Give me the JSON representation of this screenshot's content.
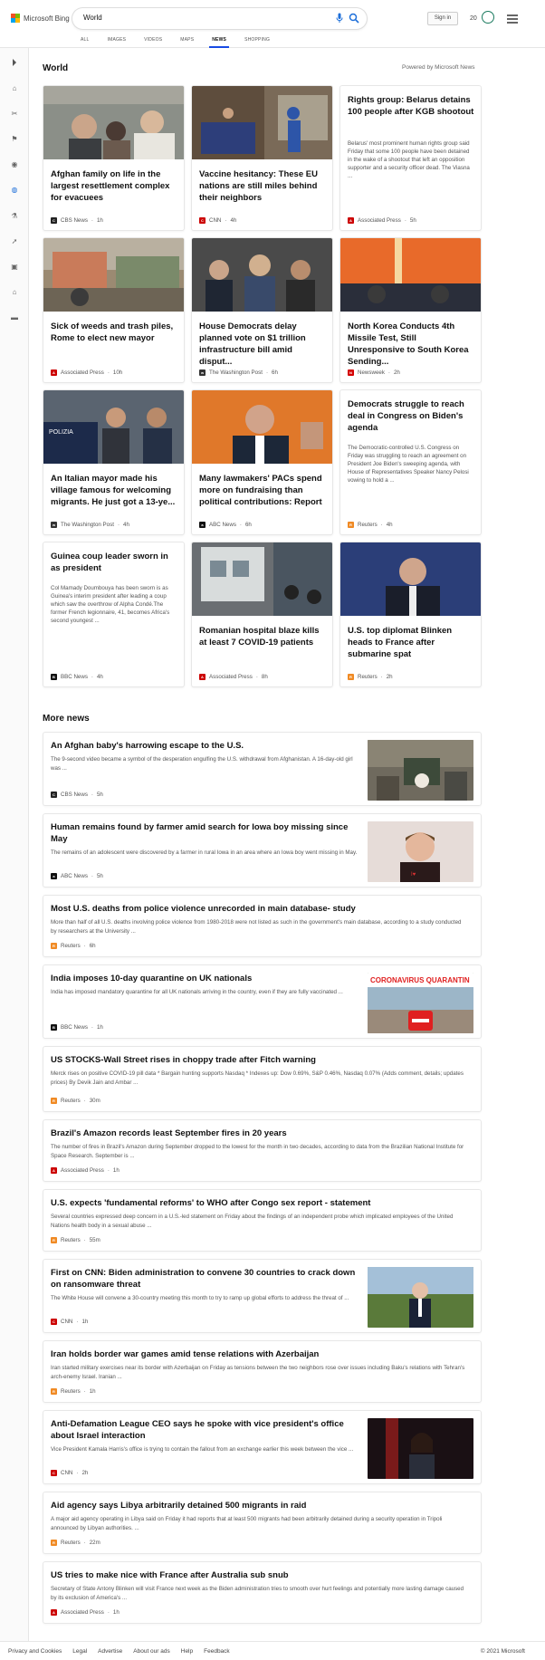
{
  "header": {
    "brand": "Microsoft Bing",
    "search_value": "World",
    "signin_label": "Sign in",
    "rewards_count": "20",
    "logo_colors": [
      "#f25022",
      "#7fba00",
      "#00a4ef",
      "#ffb900"
    ],
    "accent": "#174ae4"
  },
  "tabs": [
    {
      "label": "ALL",
      "active": false
    },
    {
      "label": "IMAGES",
      "active": false
    },
    {
      "label": "VIDEOS",
      "active": false
    },
    {
      "label": "MAPS",
      "active": false
    },
    {
      "label": "NEWS",
      "active": true
    },
    {
      "label": "SHOPPING",
      "active": false
    }
  ],
  "rail": {
    "icons": [
      "chevron-right-icon",
      "home-icon",
      "scissors-icon",
      "flag-icon",
      "location-pin-icon",
      "globe-icon",
      "microscope-icon",
      "rocket-icon",
      "film-icon",
      "bank-icon",
      "credit-card-icon"
    ]
  },
  "world": {
    "title": "World",
    "powered_by": "Powered by Microsoft News",
    "cards": [
      {
        "title": "Afghan family on life in the largest resettlement complex for evacuees",
        "source": "CBS News",
        "time": "1h",
        "src_color": "#222",
        "src_icon": "CBS",
        "has_image": true
      },
      {
        "title": "Vaccine hesitancy: These EU nations are still miles behind their neighbors",
        "source": "CNN",
        "time": "4h",
        "src_color": "#cc0000",
        "src_icon": "CNN",
        "has_image": true
      },
      {
        "title": "Rights group: Belarus detains 100 people after KGB shootout",
        "snippet": "Belarus' most prominent human rights group said Friday that some 100 people have been detained in the wake of a shootout that left an opposition supporter and a security officer dead. The Viasna ...",
        "source": "Associated Press",
        "time": "5h",
        "src_color": "#cc0000",
        "src_icon": "AP",
        "has_image": false
      },
      {
        "title": "Sick of weeds and trash piles, Rome to elect new mayor",
        "source": "Associated Press",
        "time": "10h",
        "src_color": "#cc0000",
        "src_icon": "AP",
        "has_image": true
      },
      {
        "title": "House Democrats delay planned vote on $1 trillion infrastructure bill amid disput...",
        "source": "The Washington Post",
        "time": "6h",
        "src_color": "#333",
        "src_icon": "wp",
        "has_image": true
      },
      {
        "title": "North Korea Conducts 4th Missile Test, Still Unresponsive to South Korea Sending...",
        "source": "Newsweek",
        "time": "2h",
        "src_color": "#d40000",
        "src_icon": "N",
        "has_image": true
      },
      {
        "title": "An Italian mayor made his village famous for welcoming migrants. He just got a 13-ye...",
        "source": "The Washington Post",
        "time": "4h",
        "src_color": "#333",
        "src_icon": "wp",
        "has_image": true
      },
      {
        "title": "Many lawmakers' PACs spend more on fundraising than political contributions: Report",
        "source": "ABC News",
        "time": "6h",
        "src_color": "#111",
        "src_icon": "abc",
        "has_image": true
      },
      {
        "title": "Democrats struggle to reach deal in Congress on Biden's agenda",
        "snippet": "The Democratic-controlled U.S. Congress on Friday was struggling to reach an agreement on President Joe Biden's sweeping agenda, with House of Representatives Speaker Nancy Pelosi vowing to hold a ...",
        "source": "Reuters",
        "time": "4h",
        "src_color": "#f08a24",
        "src_icon": "R",
        "has_image": false
      },
      {
        "title": "Guinea coup leader sworn in as president",
        "snippet": "Col Mamady Doumbouya has been sworn is as Guinea's interim president after leading a coup which saw the overthrow of Alpha Condé.The former French legionnaire, 41, becomes Africa's second youngest ...",
        "source": "BBC News",
        "time": "4h",
        "src_color": "#111",
        "src_icon": "BBC",
        "has_image": false
      },
      {
        "title": "Romanian hospital blaze kills at least 7 COVID-19 patients",
        "source": "Associated Press",
        "time": "8h",
        "src_color": "#cc0000",
        "src_icon": "AP",
        "has_image": true
      },
      {
        "title": "U.S. top diplomat Blinken heads to France after submarine spat",
        "source": "Reuters",
        "time": "2h",
        "src_color": "#f08a24",
        "src_icon": "R",
        "has_image": true
      }
    ]
  },
  "more_news": {
    "title": "More news",
    "items": [
      {
        "title": "An Afghan baby's harrowing escape to the U.S.",
        "snippet": "The 9-second video became a symbol of the desperation engulfing the U.S. withdrawal from Afghanistan. A 16-day-old girl was ...",
        "source": "CBS News",
        "time": "5h",
        "src_color": "#222",
        "src_icon": "CBS",
        "thumb": "baby"
      },
      {
        "title": "Human remains found by farmer amid search for Iowa boy missing since May",
        "snippet": "The remains of an adolescent were discovered by a farmer in rural Iowa in an area where an Iowa boy went missing in May.",
        "source": "ABC News",
        "time": "5h",
        "src_color": "#111",
        "src_icon": "abc",
        "thumb": "boy"
      },
      {
        "title": "Most U.S. deaths from police violence unrecorded in main database- study",
        "snippet": "More than half of all U.S. deaths involving police violence from 1980-2018 were not listed as such in the government's main database, according to a study conducted by researchers at the University ...",
        "source": "Reuters",
        "time": "6h",
        "src_color": "#f08a24",
        "src_icon": "R",
        "thumb": null
      },
      {
        "title": "India imposes 10-day quarantine on UK nationals",
        "snippet": "India has imposed mandatory quarantine for all UK nationals arriving in the country, even if they are fully vaccinated ...",
        "source": "BBC News",
        "time": "1h",
        "src_color": "#111",
        "src_icon": "BBC",
        "thumb": "quarantine",
        "thumb_text": "CORONAVIRUS QUARANTIN"
      },
      {
        "title": "US STOCKS-Wall Street rises in choppy trade after Fitch warning",
        "snippet": "Merck rises on positive COVID-19 pill data * Bargain hunting supports Nasdaq * Indexes up: Dow 0.69%, S&P 0.46%, Nasdaq 0.07% (Adds comment, details; updates prices) By Devik Jain and Ambar ...",
        "source": "Reuters",
        "time": "30m",
        "src_color": "#f08a24",
        "src_icon": "R",
        "thumb": null
      },
      {
        "title": "Brazil's Amazon records least September fires in 20 years",
        "snippet": "The number of fires in Brazil's Amazon during September dropped to the lowest for the month in two decades, according to data from the Brazilian National Institute for Space Research. September is ...",
        "source": "Associated Press",
        "time": "1h",
        "src_color": "#cc0000",
        "src_icon": "AP",
        "thumb": null
      },
      {
        "title": "U.S. expects 'fundamental reforms' to WHO after Congo sex report - statement",
        "snippet": "Several countries expressed deep concern in a U.S.-led statement on Friday about the findings of an independent probe which implicated employees of the United Nations health body in a sexual abuse ...",
        "source": "Reuters",
        "time": "55m",
        "src_color": "#f08a24",
        "src_icon": "R",
        "thumb": null
      },
      {
        "title": "First on CNN: Biden administration to convene 30 countries to crack down on ransomware threat",
        "snippet": "The White House will convene a 30-country meeting this month to try to ramp up global efforts to address the threat of ...",
        "source": "CNN",
        "time": "1h",
        "src_color": "#cc0000",
        "src_icon": "CNN",
        "thumb": "biden"
      },
      {
        "title": "Iran holds border war games amid tense relations with Azerbaijan",
        "snippet": "Iran started military exercises near its border with Azerbaijan on Friday as tensions between the two neighbors rose over issues including Baku's relations with Tehran's arch-enemy Israel. Iranian ...",
        "source": "Reuters",
        "time": "1h",
        "src_color": "#f08a24",
        "src_icon": "R",
        "thumb": null
      },
      {
        "title": "Anti-Defamation League CEO says he spoke with vice president's office about Israel interaction",
        "snippet": "Vice President Kamala Harris's office is trying to contain the fallout from an exchange earlier this week between the vice ...",
        "source": "CNN",
        "time": "2h",
        "src_color": "#cc0000",
        "src_icon": "CNN",
        "thumb": "harris"
      },
      {
        "title": "Aid agency says Libya arbitrarily detained 500 migrants in raid",
        "snippet": "A major aid agency operating in Libya said on Friday it had reports that at least 500 migrants had been arbitrarily detained during a security operation in Tripoli announced by Libyan authorities. ...",
        "source": "Reuters",
        "time": "22m",
        "src_color": "#f08a24",
        "src_icon": "R",
        "thumb": null
      },
      {
        "title": "US tries to make nice with France after Australia sub snub",
        "snippet": "Secretary of State Antony Blinken will visit France next week as the Biden administration tries to smooth over hurt feelings and potentially more lasting damage caused by its exclusion of America's ...",
        "source": "Associated Press",
        "time": "1h",
        "src_color": "#cc0000",
        "src_icon": "AP",
        "thumb": null
      }
    ]
  },
  "footer": {
    "links": [
      "Privacy and Cookies",
      "Legal",
      "Advertise",
      "About our ads",
      "Help",
      "Feedback"
    ],
    "copyright": "© 2021 Microsoft"
  }
}
